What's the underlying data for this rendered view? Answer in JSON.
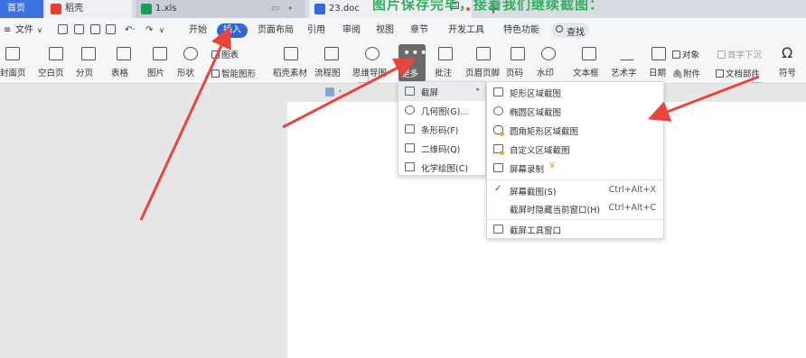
{
  "tabs": {
    "home": "首页",
    "daoke": "稻壳",
    "xls": "1.xls",
    "doc": "23.doc",
    "add": "+"
  },
  "banner_text": "图片保存完毕，接着我们继续截图：",
  "menubar": {
    "file": "文件",
    "items": [
      "开始",
      "插入",
      "页面布局",
      "引用",
      "审阅",
      "视图",
      "章节",
      "开发工具",
      "特色功能"
    ],
    "search": "查找"
  },
  "ribbon": {
    "cover": "封面页",
    "blank": "空白页",
    "pagebreak": "分页",
    "table": "表格",
    "picture": "图片",
    "shape": "形状",
    "chart": "图表",
    "smartart": "智能图形",
    "material": "稻壳素材",
    "flowchart": "流程图",
    "mindmap": "思维导图",
    "more": "更多",
    "comment": "批注",
    "header_footer": "页眉页脚",
    "page_number": "页码",
    "watermark": "水印",
    "textbox": "文本框",
    "wordart": "艺术字",
    "date": "日期",
    "object": "对象",
    "dropcap": "首字下沉",
    "attachment": "附件",
    "docparts": "文档部件",
    "symbol": "符号"
  },
  "menu1": {
    "items": [
      "截屏",
      "几何图(G)...",
      "条形码(F)",
      "二维码(Q)",
      "化学绘图(C)"
    ]
  },
  "menu2": {
    "rect": "矩形区域截图",
    "ellipse": "椭圆区域截图",
    "rounded": "圆角矩形区域截图",
    "custom": "自定义区域截图",
    "record": "屏幕录制",
    "screen": "屏幕截图(S)",
    "screen_shortcut": "Ctrl+Alt+X",
    "hide": "截屏时隐藏当前窗口(H)",
    "hide_shortcut": "Ctrl+Alt+C",
    "toolwin": "截屏工具窗口"
  },
  "colors": {
    "accent": "#2f66d9",
    "tab_home": "#3b72e0",
    "arrow": "#e8453c",
    "banner": "#32b060"
  }
}
